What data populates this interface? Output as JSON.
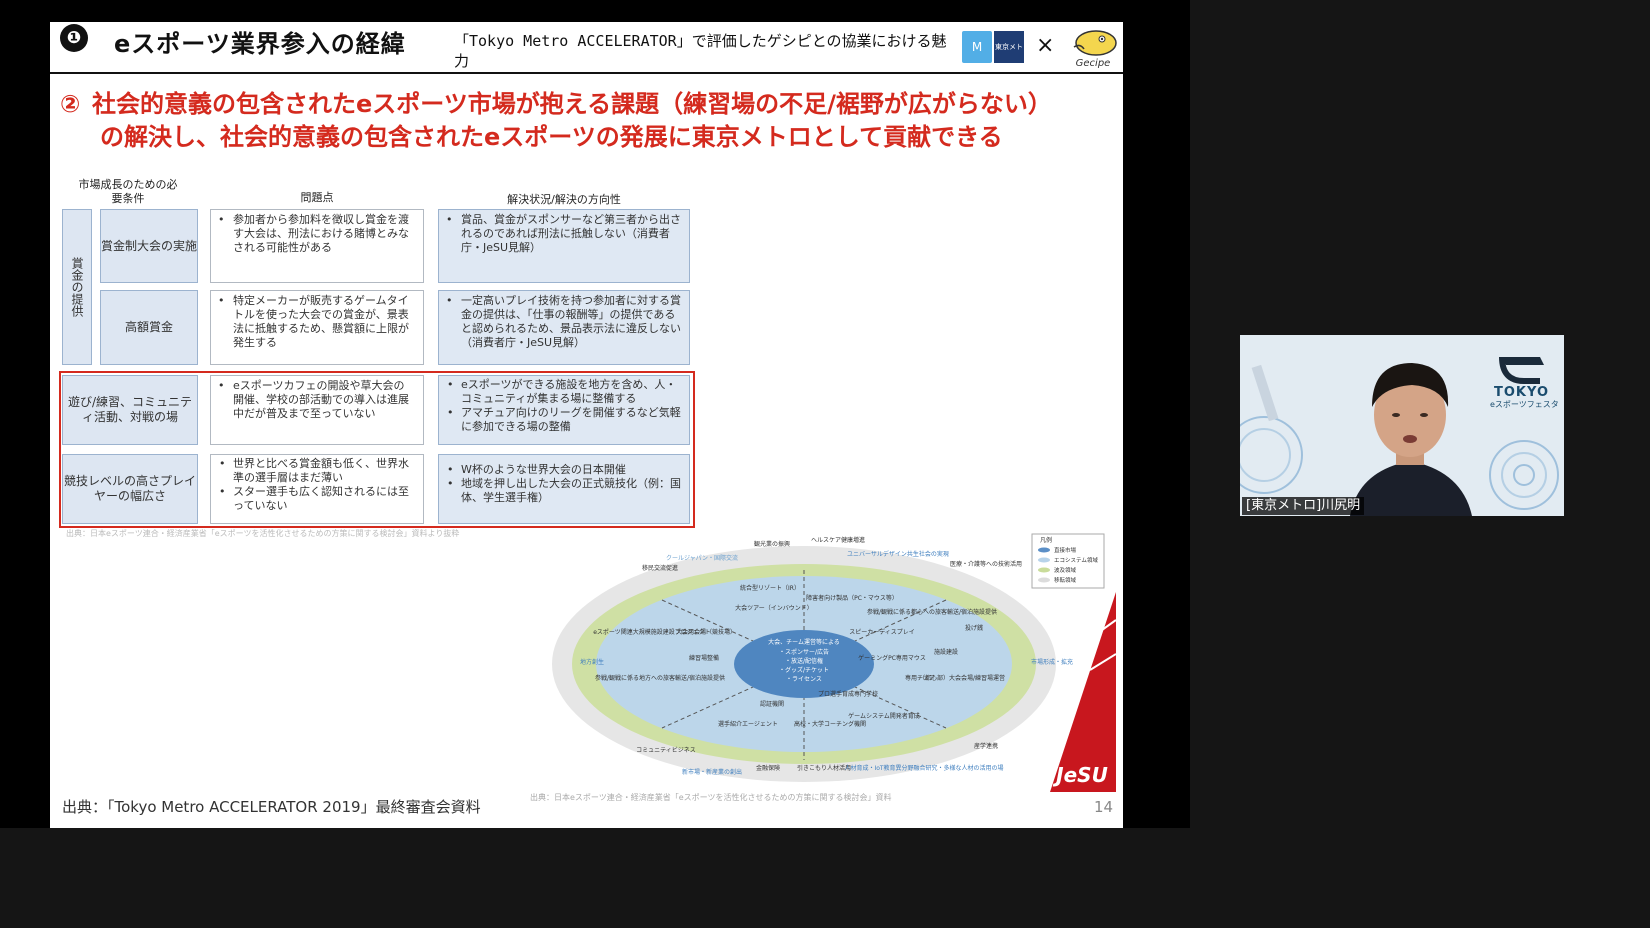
{
  "slide": {
    "header": {
      "number": "❶",
      "title": "eスポーツ業界参入の経緯",
      "subtitle": "「Tokyo Metro ACCELERATOR」で評価したゲシピとの協業における魅力",
      "cross": "×",
      "metro_logo": "M",
      "tokyo_metro_logo": "東京メトロ",
      "gecipe_logo": "Gecipe"
    },
    "headline": {
      "circle": "②",
      "line1": "社会的意義の包含されたeスポーツ市場が抱える課題（練習場の不足/裾野が広がらない）",
      "line2": "の解決し、社会的意義の包含されたeスポーツの発展に東京メトロとして貢献できる"
    },
    "table": {
      "col_headers": [
        "市場成長のための必要条件",
        "問題点",
        "解決状況/解決の方向性"
      ],
      "group_label": "賞金の提供",
      "rows": [
        {
          "condition": "賞金制大会の実施",
          "problem": "参加者から参加料を徴収し賞金を渡す大会は、刑法における賭博とみなされる可能性がある",
          "solution": "賞品、賞金がスポンサーなど第三者から出されるのであれば刑法に抵触しない（消費者庁・JeSU見解）"
        },
        {
          "condition": "高額賞金",
          "problem": "特定メーカーが販売するゲームタイトルを使った大会での賞金が、景表法に抵触するため、懸賞額に上限が発生する",
          "solution": "一定高いプレイ技術を持つ参加者に対する賞金の提供は、「仕事の報酬等」の提供であると認められるため、景品表示法に違反しない（消費者庁・JeSU見解）"
        },
        {
          "condition": "遊び/練習、コミュニティ活動、対戦の場",
          "problem": "eスポーツカフェの開設や草大会の開催、学校の部活動での導入は進展中だが普及まで至っていない",
          "solution": [
            "eスポーツができる施設を地方を含め、人・コミュニティが集まる場に整備する",
            "アマチュア向けのリーグを開催するなど気軽に参加できる場の整備"
          ]
        },
        {
          "condition": "競技レベルの高さプレイヤーの幅広さ",
          "problem": [
            "世界と比べる賞金額も低く、世界水準の選手層はまだ薄い",
            "スター選手も広く認知されるには至っていない"
          ],
          "solution": [
            "W杯のような世界大会の日本開催",
            "地域を押し出した大会の正式競技化（例：国体、学生選手権）"
          ]
        }
      ],
      "bullet": "•",
      "source_note": "出典：日本eスポーツ連合・経済産業省「eスポーツを活性化させるための方策に関する検討会」資料より抜粋"
    },
    "diagram": {
      "center": [
        "大会、チーム運営等による",
        "・スポンサー/広告",
        "・放送/配信権",
        "・グッズ/チケット",
        "・ライセンス"
      ],
      "inner": [
        "統合型リゾート（IR）",
        "大会ツアー（インバウンド）",
        "障害者向け製品（PC・マウス等）",
        "eスポーツ関連大規模施設建設プロジェクト",
        "大会用会場（競技場）",
        "練習場整備",
        "スピーカーディスプレイ",
        "ゲーミングPC専用マウス",
        "施設建設",
        "参戦/観戦に係る地方への旅客輸送/宿泊施設提供",
        "プロ選手育成専門学校",
        "ゲームシステム開発者育成",
        "認証機関",
        "選手紹介エージェント",
        "高校・大学コーチング機関",
        "専用チェア",
        "（都心部）大会会場/練習場運営",
        "参戦/観戦に係る都心への旅客輸送/宿泊施設提供",
        "投げ銭"
      ],
      "outer": [
        "観光業の振興",
        "ヘルスケア健康増進",
        "クールジャパン・国際交流",
        "ユニバーサルデザイン共生社会の実現",
        "医療・介護等への技術活用",
        "移民交流促進",
        "地方創生",
        "市場形成・拡充",
        "コミュニティビジネス",
        "新市場・新産業の創出",
        "金融保険",
        "引きこもり人材活用",
        "人材育成・IoT教育異分野融合研究・多様な人材の活用の場",
        "産学連携"
      ],
      "legend_title": "凡例",
      "legend": [
        "直接市場",
        "エコシステム領域",
        "波及領域",
        "移転領域"
      ],
      "legend_colors": [
        "#5b8fc7",
        "#b7d3ea",
        "#c9dc9a",
        "#dcdcdc"
      ],
      "jesu_logo": "JeSU",
      "source_note": "出典：日本eスポーツ連合・経済産業省「eスポーツを活性化させるための方策に関する検討会」資料"
    },
    "footer": "出典：「Tokyo Metro ACCELERATOR 2019」最終審査会資料",
    "page_number": "14"
  },
  "video": {
    "participant_name": "[東京メトロ]川尻明",
    "backdrop_logo": "TOKYO",
    "backdrop_sub": "eスポーツフェスタ"
  },
  "colors": {
    "accent_red": "#d42a1e",
    "box_blue": "#dde6f2",
    "ellipse_outer": "#e4e4e4",
    "ellipse_green": "#c9dc9a",
    "ellipse_light": "#b7d3ea",
    "ellipse_core": "#4f86c0"
  }
}
